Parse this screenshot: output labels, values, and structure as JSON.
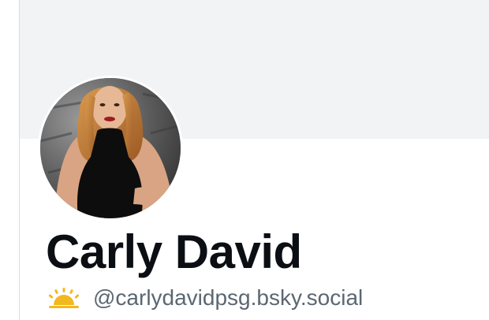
{
  "profile": {
    "display_name": "Carly David",
    "handle": "@carlydavidpsg.bsky.social",
    "avatar_alt": "profile photo",
    "handle_icon": "sunrise-icon"
  },
  "colors": {
    "banner": "#f1f3f5",
    "name_text": "#0b0f14",
    "handle_text": "#5b6772",
    "icon_yellow": "#f2b81f"
  }
}
